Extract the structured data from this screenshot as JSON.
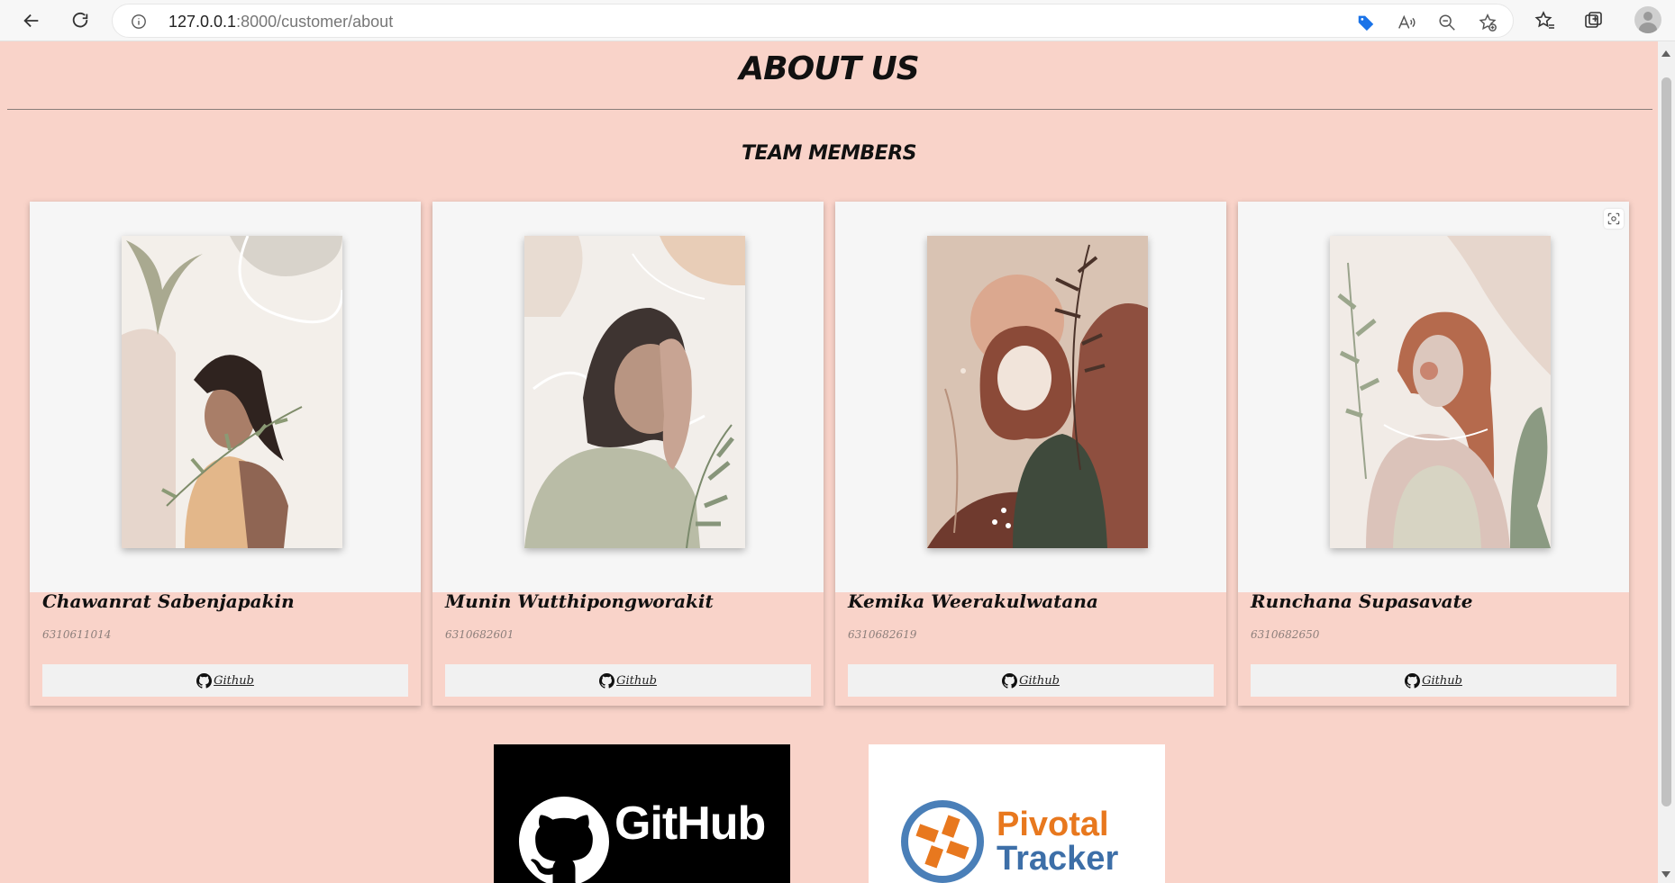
{
  "browser": {
    "url_host": "127.0.0.1",
    "url_rest": ":8000/customer/about"
  },
  "page": {
    "title": "ABOUT US",
    "section_title": "TEAM MEMBERS"
  },
  "members": [
    {
      "name": "Chawanrat Sabenjapakin",
      "student_id": "6310611014",
      "link_label": "Github"
    },
    {
      "name": "Munin Wutthipongworakit",
      "student_id": "6310682601",
      "link_label": "Github"
    },
    {
      "name": "Kemika Weerakulwatana",
      "student_id": "6310682619",
      "link_label": "Github"
    },
    {
      "name": "Runchana Supasavate",
      "student_id": "6310682650",
      "link_label": "Github"
    }
  ],
  "logos": {
    "github": "GitHub",
    "pivotal_line1": "Pivotal",
    "pivotal_line2": "Tracker"
  },
  "colors": {
    "page_bg": "#f9d3c9",
    "card_photo_bg": "#f6f6f6",
    "button_bg": "#f1f1f1"
  }
}
